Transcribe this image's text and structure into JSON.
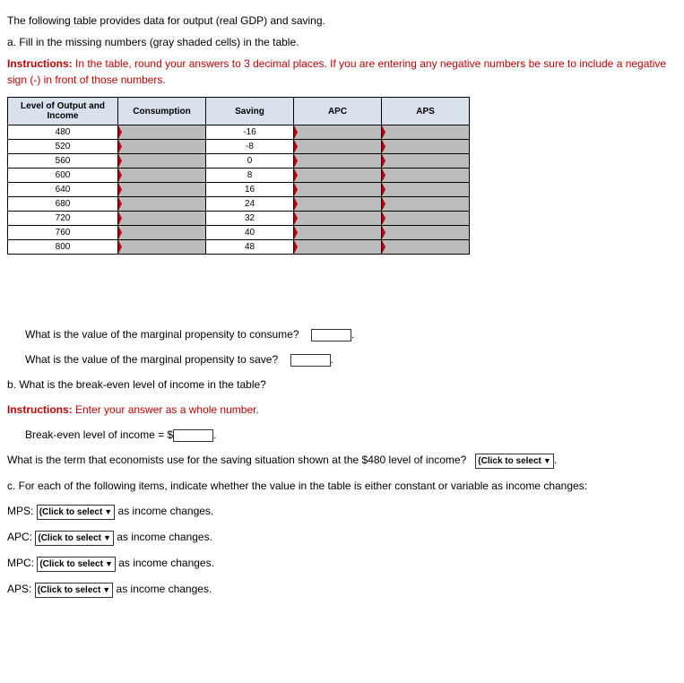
{
  "intro": "The following table provides data for output (real GDP) and saving.",
  "part_a": "a. Fill in the missing numbers (gray shaded cells) in the table.",
  "instructions_label": "Instructions:",
  "instructions_a": " In the table, round your answers to 3 decimal places. If you are entering any negative numbers be sure to include a negative sign (-) in front of those numbers.",
  "headers": {
    "c1": "Level of Output and Income",
    "c2": "Consumption",
    "c3": "Saving",
    "c4": "APC",
    "c5": "APS"
  },
  "rows": [
    {
      "income": "480",
      "saving": "-16"
    },
    {
      "income": "520",
      "saving": "-8"
    },
    {
      "income": "560",
      "saving": "0"
    },
    {
      "income": "600",
      "saving": "8"
    },
    {
      "income": "640",
      "saving": "16"
    },
    {
      "income": "680",
      "saving": "24"
    },
    {
      "income": "720",
      "saving": "32"
    },
    {
      "income": "760",
      "saving": "40"
    },
    {
      "income": "800",
      "saving": "48"
    }
  ],
  "q_mpc": "What is the value of the marginal propensity to consume?",
  "q_mps": "What is the value of the marginal propensity to save?",
  "part_b": "b. What is the break-even level of income in the table?",
  "instructions_b": " Enter your answer as a whole number.",
  "breakeven_label": "Break-even level of income = $",
  "term_q": "What is the term that economists use for the saving situation shown at the $480 level of income?",
  "part_c": "c. For each of the following items, indicate whether the value in the table is either constant or variable as income changes:",
  "select_placeholder": "(Click to select",
  "arrow": "▼",
  "as_income": " as income changes.",
  "labels": {
    "mps": "MPS:",
    "apc": "APC:",
    "mpc": "MPC:",
    "aps": "APS:"
  },
  "period": "."
}
